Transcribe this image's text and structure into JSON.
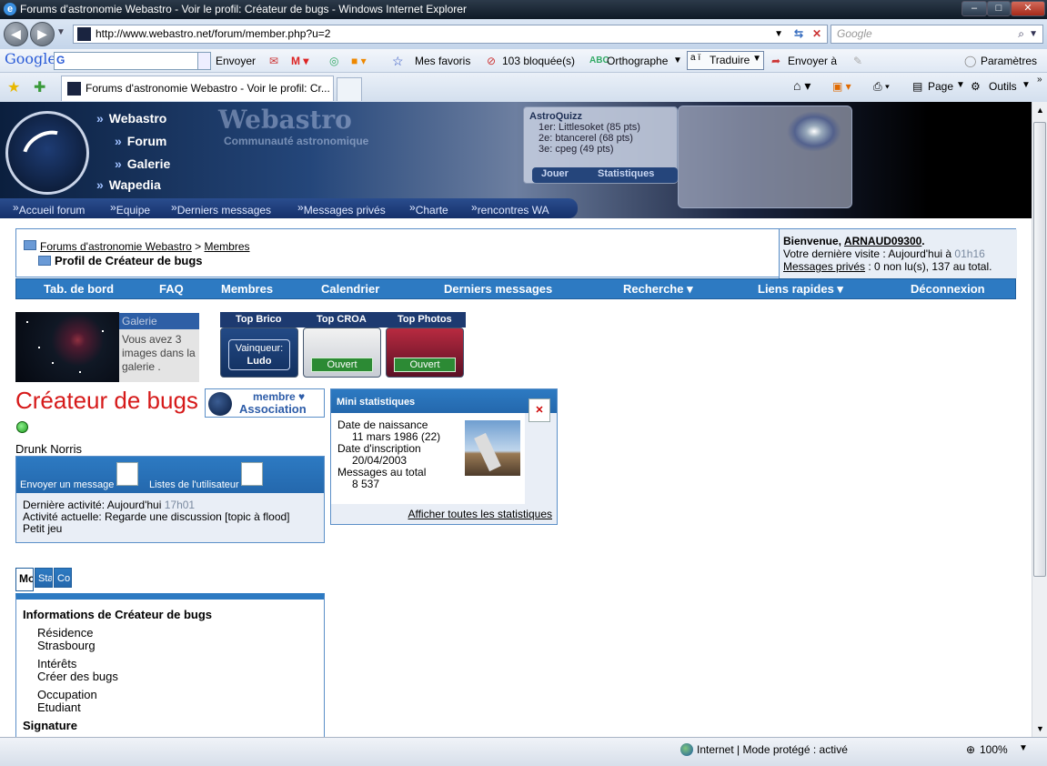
{
  "window": {
    "title": "Forums d'astronomie Webastro - Voir le profil: Créateur de bugs - Windows Internet Explorer",
    "min": "–",
    "max": "□",
    "close": "✕"
  },
  "address": {
    "url": "http://www.webastro.net/forum/member.php?u=2",
    "search_placeholder": "Google"
  },
  "googlebar": {
    "logo": "Google",
    "send": "Envoyer",
    "favorites": "Mes favoris",
    "blocked": "103 bloquée(s)",
    "spelling": "Orthographe",
    "translate": "Traduire",
    "send_to": "Envoyer à",
    "settings": "Paramètres"
  },
  "tabs": {
    "active": "Forums d'astronomie Webastro - Voir le profil: Cr...",
    "page": "Page",
    "tools": "Outils"
  },
  "banner": {
    "nav": [
      "Webastro",
      "Forum",
      "Galerie",
      "Wapedia"
    ],
    "site_title": "Webastro",
    "site_subtitle": "Communauté astronomique",
    "quizz_title": "AstroQuizz",
    "quizz_rows": [
      "1er: Littlesoket (85 pts)",
      "2e: btancerel (68 pts)",
      "3e: cpeg (49 pts)"
    ],
    "quizz_play": "Jouer",
    "quizz_stats": "Statistiques",
    "bottom_nav": [
      "Accueil forum",
      "Equipe",
      "Derniers messages",
      "Messages privés",
      "Charte",
      "rencontres WA"
    ]
  },
  "breadcrumb": {
    "forum": "Forums d'astronomie Webastro",
    "sep": ">",
    "members": "Membres",
    "title": "Profil de Créateur de bugs"
  },
  "welcome": {
    "label": "Bienvenue,",
    "user": "ARNAUD09300",
    "dot": ".",
    "last_visit": "Votre dernière visite : Aujourd'hui à",
    "last_visit_time": "01h16",
    "pm_link": "Messages privés",
    "pm_text": ": 0 non lu(s), 137 au total."
  },
  "navbar": [
    "Tab. de bord",
    "FAQ",
    "Membres",
    "Calendrier",
    "Derniers messages",
    "Recherche ▾",
    "Liens rapides ▾",
    "Déconnexion"
  ],
  "gallery": {
    "head": "Galerie",
    "text": "Vous avez 3 images dans la galerie ."
  },
  "tops": {
    "heads": [
      "Top Brico",
      "Top CROA",
      "Top Photos"
    ],
    "winner_label": "Vainqueur:",
    "winner_name": "Ludo",
    "open1": "Ouvert",
    "open2": "Ouvert"
  },
  "member": {
    "name": "Créateur de bugs",
    "badge_line1": "membre ♥",
    "badge_line2": "Association",
    "subtitle": "Drunk Norris"
  },
  "actions": {
    "send_message": "Envoyer un message",
    "user_lists": "Listes de l'utilisateur",
    "last_activity_label": "Dernière activité: Aujourd'hui",
    "last_activity_time": "17h01",
    "current_activity": "Activité actuelle: Regarde une discussion [topic à flood]",
    "current_activity_2": "Petit jeu"
  },
  "ministats": {
    "title": "Mini statistiques",
    "birth_label": "Date de naissance",
    "birth_value": "11 mars 1986 (22)",
    "join_label": "Date d'inscription",
    "join_value": "20/04/2003",
    "posts_label": "Messages au total",
    "posts_value": "8 537",
    "all_link": "Afficher toutes les statistiques"
  },
  "profile_tabs": [
    "Mo",
    "Sta",
    "Co"
  ],
  "info": {
    "header": "Informations de Créateur de bugs",
    "res_label": "Résidence",
    "res_value": "Strasbourg",
    "int_label": "Intérêts",
    "int_value": "Créer des bugs",
    "occ_label": "Occupation",
    "occ_value": "Etudiant",
    "signature": "Signature"
  },
  "status": {
    "zone": "Internet | Mode protégé : activé",
    "zoom": "100%"
  }
}
